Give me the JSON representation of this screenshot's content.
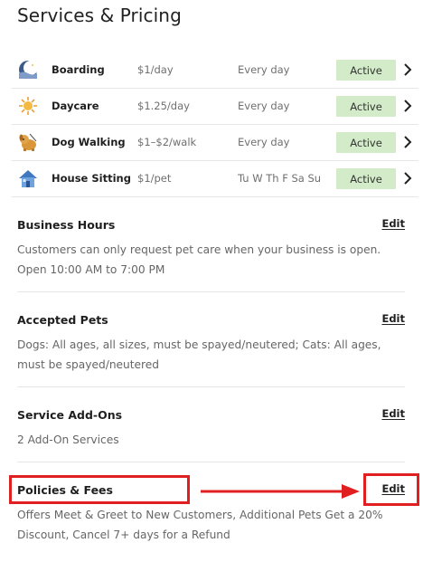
{
  "page": {
    "title": "Services & Pricing"
  },
  "services": [
    {
      "icon": "moon-icon",
      "name": "Boarding",
      "price": "$1/day",
      "schedule": "Every day",
      "status": "Active"
    },
    {
      "icon": "sun-icon",
      "name": "Daycare",
      "price": "$1.25/day",
      "schedule": "Every day",
      "status": "Active"
    },
    {
      "icon": "dog-icon",
      "name": "Dog Walking",
      "price": "$1–$2/walk",
      "schedule": "Every day",
      "status": "Active"
    },
    {
      "icon": "house-icon",
      "name": "House Sitting",
      "price": "$1/pet",
      "schedule": "Tu W Th F Sa Su",
      "status": "Active"
    }
  ],
  "sections": {
    "business_hours": {
      "title": "Business Hours",
      "edit": "Edit",
      "description": [
        "Customers can only request pet care when your business is open.",
        "Open 10:00 AM to 7:00 PM"
      ]
    },
    "accepted_pets": {
      "title": "Accepted Pets",
      "edit": "Edit",
      "description": [
        "Dogs: All ages, all sizes, must be spayed/neutered; Cats: All ages,",
        "must be spayed/neutered"
      ]
    },
    "service_addons": {
      "title": "Service Add-Ons",
      "edit": "Edit",
      "description": [
        "2 Add-On Services"
      ]
    },
    "policies_fees": {
      "title": "Policies & Fees",
      "edit": "Edit",
      "description": [
        "Offers Meet & Greet to New Customers, Additional Pets Get a 20%",
        "Discount, Cancel 7+ days for a Refund"
      ]
    }
  },
  "colors": {
    "active_badge_bg": "#d3ebc8",
    "highlight": "#e02020",
    "muted_text": "#666666"
  }
}
